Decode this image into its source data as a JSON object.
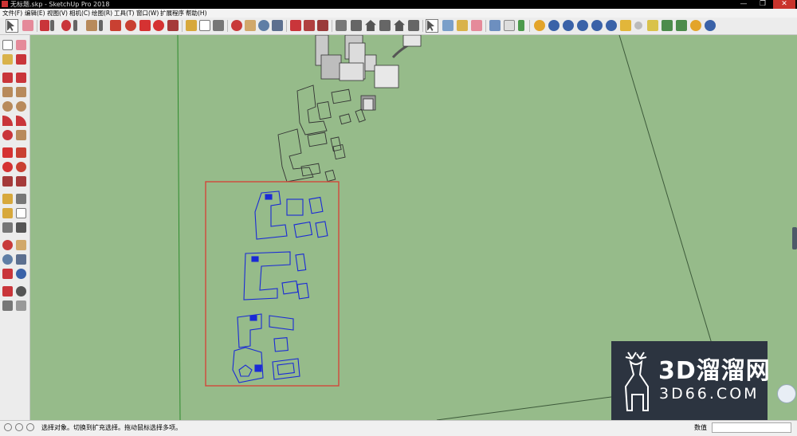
{
  "window": {
    "title": "无标题.skp - SketchUp Pro 2018",
    "minimize_glyph": "—",
    "maximize_glyph": "❐",
    "close_glyph": "✕"
  },
  "menu": [
    "文件(F)",
    "编辑(E)",
    "视图(V)",
    "相机(C)",
    "绘图(R)",
    "工具(T)",
    "窗口(W)",
    "扩展程序",
    "帮助(H)"
  ],
  "colors": {
    "canvas": "#96bb8a",
    "selection_blue": "#1a2ad6",
    "selection_box": "#d2473a",
    "green_axis": "#2d8a2d"
  },
  "watermark": {
    "text": "3D溜溜网",
    "domain": "3D66.COM",
    "icon": "deer-logo-icon"
  },
  "status": {
    "icons": [
      "geolocation-icon",
      "credits-icon",
      "help-icon"
    ],
    "text": "选择对象。切换到扩充选择。拖动鼠标选择多项。",
    "measurements_label": "数值",
    "measurements_value": ""
  }
}
